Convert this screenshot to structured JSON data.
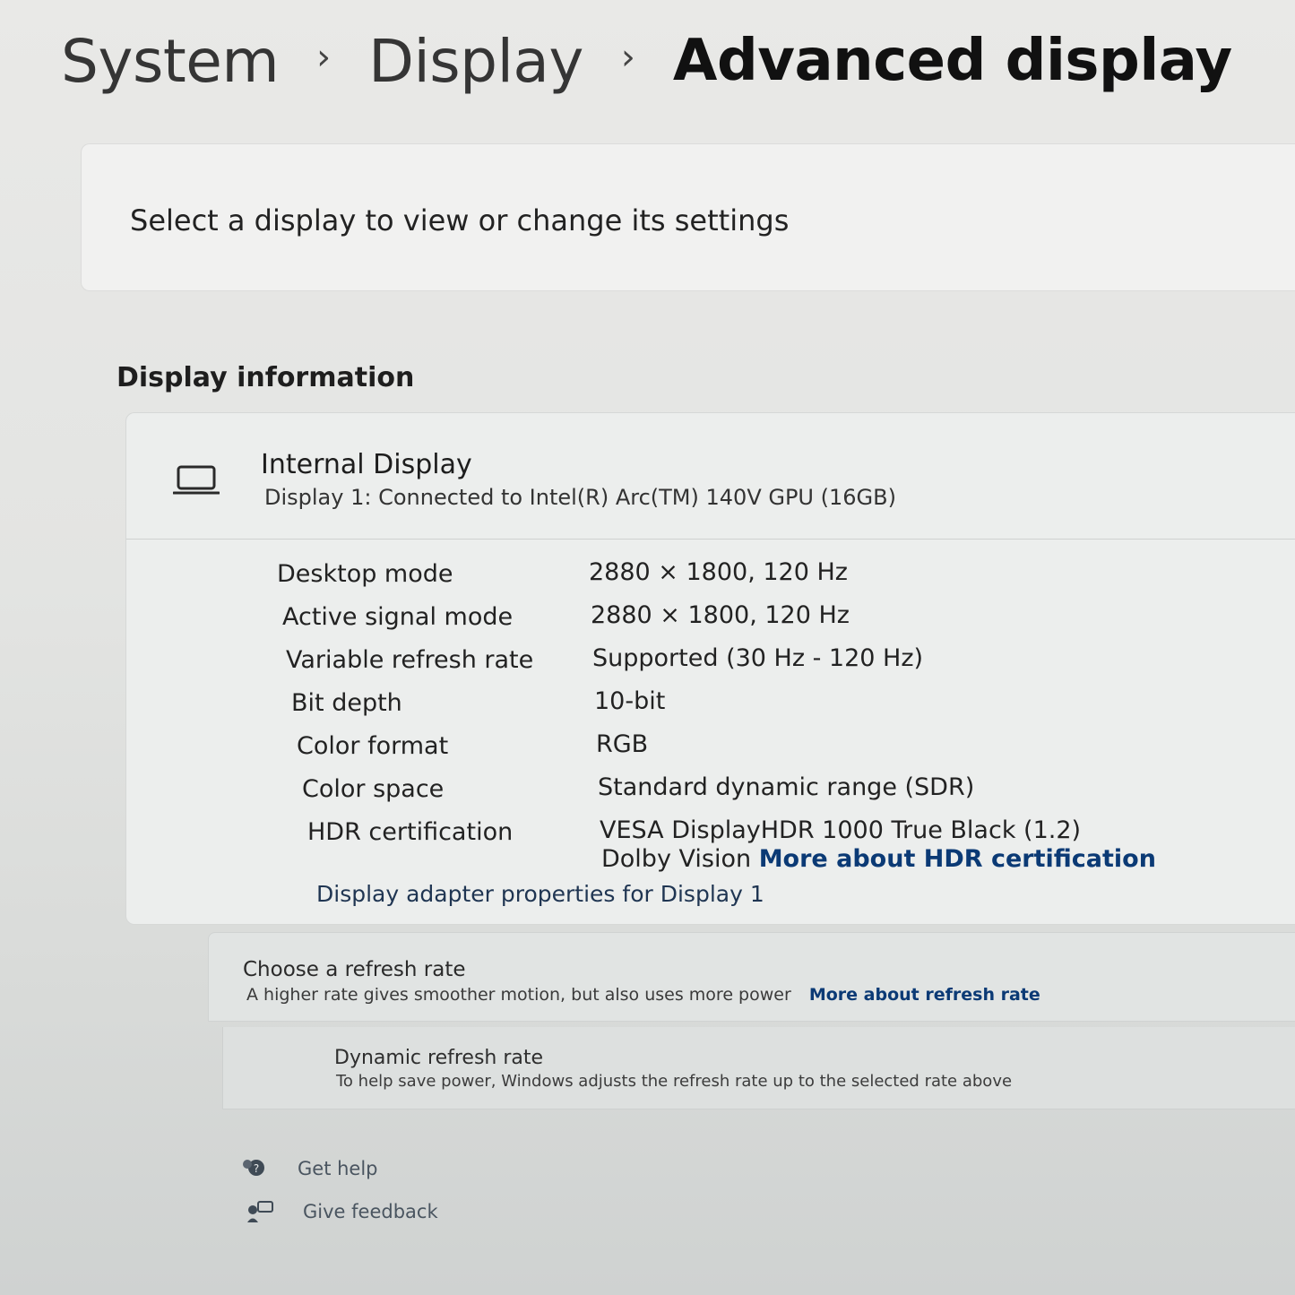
{
  "breadcrumb": {
    "items": [
      "System",
      "Display",
      "Advanced display"
    ]
  },
  "select_card": {
    "text": "Select a display to view or change its settings"
  },
  "display_info": {
    "section_title": "Display information",
    "display_name": "Internal Display",
    "display_subtitle": "Display 1: Connected to Intel(R) Arc(TM) 140V GPU (16GB)",
    "specs": [
      {
        "label": "Desktop mode",
        "value": "2880 × 1800, 120 Hz"
      },
      {
        "label": "Active signal mode",
        "value": "2880 × 1800, 120 Hz"
      },
      {
        "label": "Variable refresh rate",
        "value": "Supported (30 Hz - 120 Hz)"
      },
      {
        "label": "Bit depth",
        "value": "10-bit"
      },
      {
        "label": "Color format",
        "value": "RGB"
      },
      {
        "label": "Color space",
        "value": "Standard dynamic range (SDR)"
      },
      {
        "label": "HDR certification",
        "value": "VESA DisplayHDR 1000 True Black (1.2)",
        "value2": "Dolby Vision",
        "link": "More about HDR certification"
      }
    ],
    "adapter_link": "Display adapter properties for Display 1"
  },
  "refresh_rate": {
    "title": "Choose a refresh rate",
    "subtitle": "A higher rate gives smoother motion, but also uses more power",
    "link": "More about refresh rate"
  },
  "dynamic_refresh": {
    "title": "Dynamic refresh rate",
    "subtitle": "To help save power, Windows adjusts the refresh rate up to the selected rate above"
  },
  "footer": {
    "get_help": "Get help",
    "give_feedback": "Give feedback"
  },
  "icons": {
    "display": "laptop-icon",
    "help": "help-icon",
    "feedback": "feedback-icon"
  },
  "colors": {
    "link": "#0b3a75"
  }
}
